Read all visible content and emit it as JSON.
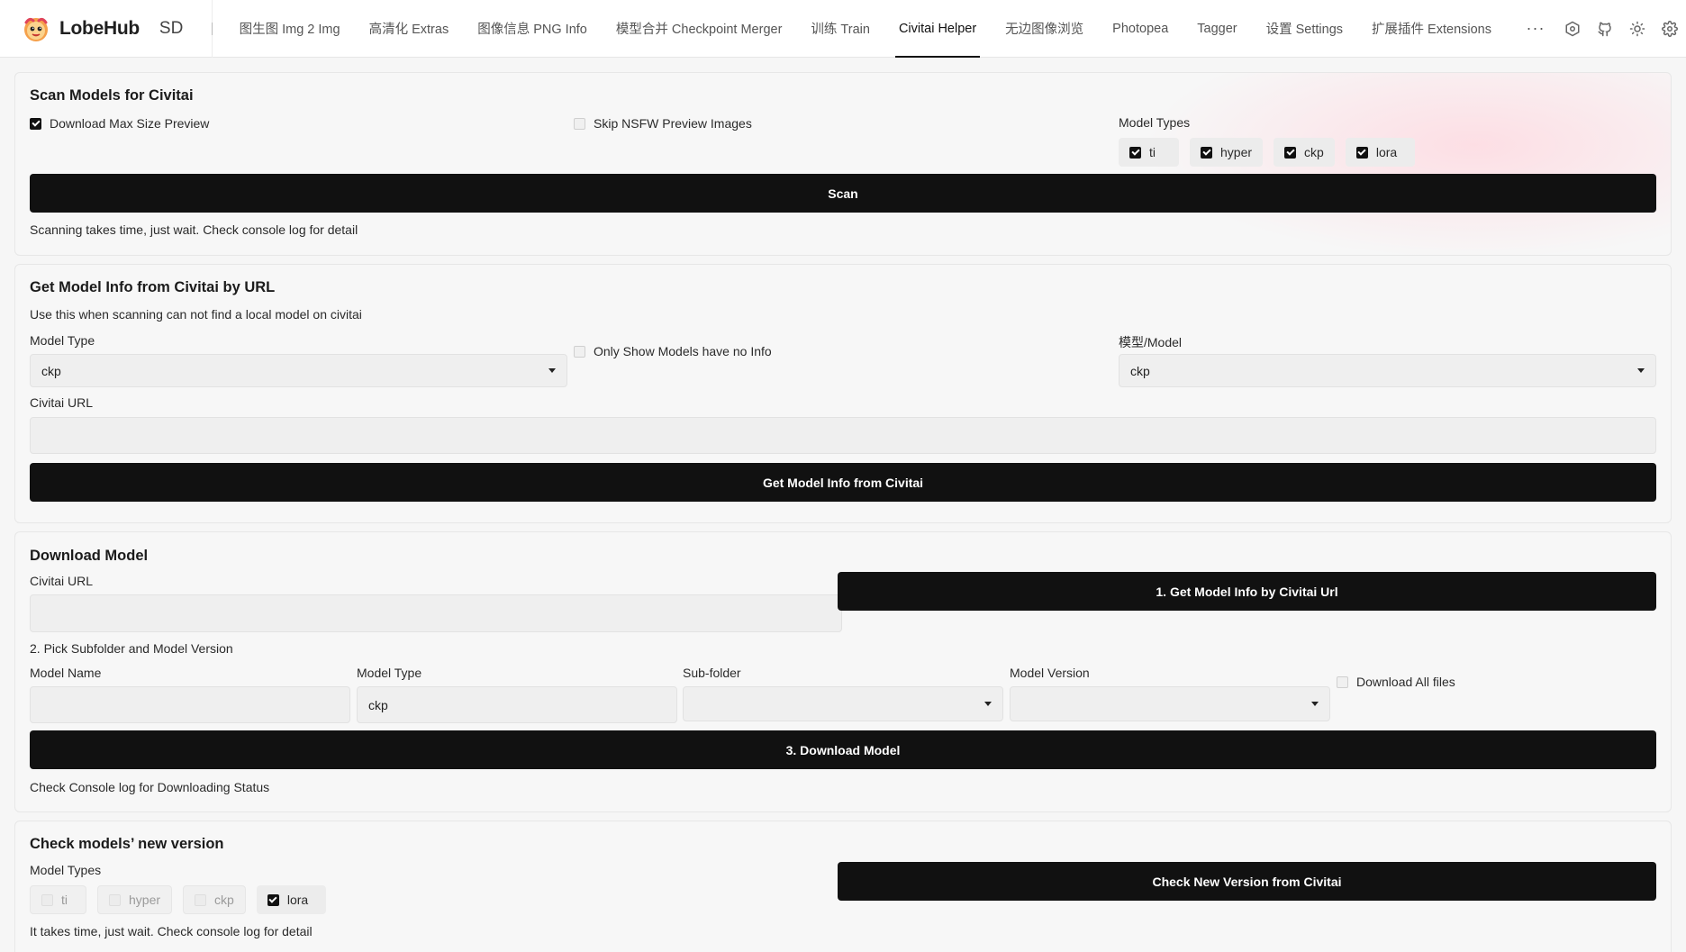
{
  "brand": {
    "name": "LobeHub",
    "sub": "SD"
  },
  "tabs": [
    {
      "label": "图生图 Img 2 Img"
    },
    {
      "label": "高清化 Extras"
    },
    {
      "label": "图像信息 PNG Info"
    },
    {
      "label": "模型合并 Checkpoint Merger"
    },
    {
      "label": "训练 Train"
    },
    {
      "label": "Civitai Helper",
      "active": true
    },
    {
      "label": "无边图像浏览"
    },
    {
      "label": "Photopea"
    },
    {
      "label": "Tagger"
    },
    {
      "label": "设置 Settings"
    },
    {
      "label": "扩展插件 Extensions"
    }
  ],
  "more_label": "···",
  "icons": [
    "hexagon-icon",
    "github-icon",
    "sun-icon",
    "gear-icon"
  ],
  "scan": {
    "title": "Scan Models for Civitai",
    "download_max": "Download Max Size Preview",
    "skip_nsfw": "Skip NSFW Preview Images",
    "model_types_label": "Model Types",
    "types": [
      {
        "label": "ti",
        "checked": true
      },
      {
        "label": "hyper",
        "checked": true
      },
      {
        "label": "ckp",
        "checked": true
      },
      {
        "label": "lora",
        "checked": true
      }
    ],
    "button": "Scan",
    "note": "Scanning takes time, just wait. Check console log for detail"
  },
  "url_info": {
    "title": "Get Model Info from Civitai by URL",
    "desc": "Use this when scanning can not find a local model on civitai",
    "model_type_label": "Model Type",
    "model_type_value": "ckp",
    "only_show": "Only Show Models have no Info",
    "model_label": "模型/Model",
    "model_value": "ckp",
    "civitai_url_label": "Civitai URL",
    "civitai_url_value": "",
    "button": "Get Model Info from Civitai"
  },
  "download": {
    "title": "Download Model",
    "civitai_url_label": "Civitai URL",
    "civitai_url_value": "",
    "get_info_button": "1. Get Model Info by Civitai Url",
    "pick_label": "2. Pick Subfolder and Model Version",
    "model_name_label": "Model Name",
    "model_name_value": "",
    "model_type_label": "Model Type",
    "model_type_value": "ckp",
    "subfolder_label": "Sub-folder",
    "subfolder_value": "",
    "version_label": "Model Version",
    "version_value": "",
    "download_all": "Download All files",
    "download_button": "3. Download Model",
    "status_note": "Check Console log for Downloading Status"
  },
  "check": {
    "title": "Check models’ new version",
    "model_types_label": "Model Types",
    "types": [
      {
        "label": "ti",
        "checked": false
      },
      {
        "label": "hyper",
        "checked": false
      },
      {
        "label": "ckp",
        "checked": false
      },
      {
        "label": "lora",
        "checked": true
      }
    ],
    "button": "Check New Version from Civitai",
    "note": "It takes time, just wait. Check console log for detail"
  }
}
